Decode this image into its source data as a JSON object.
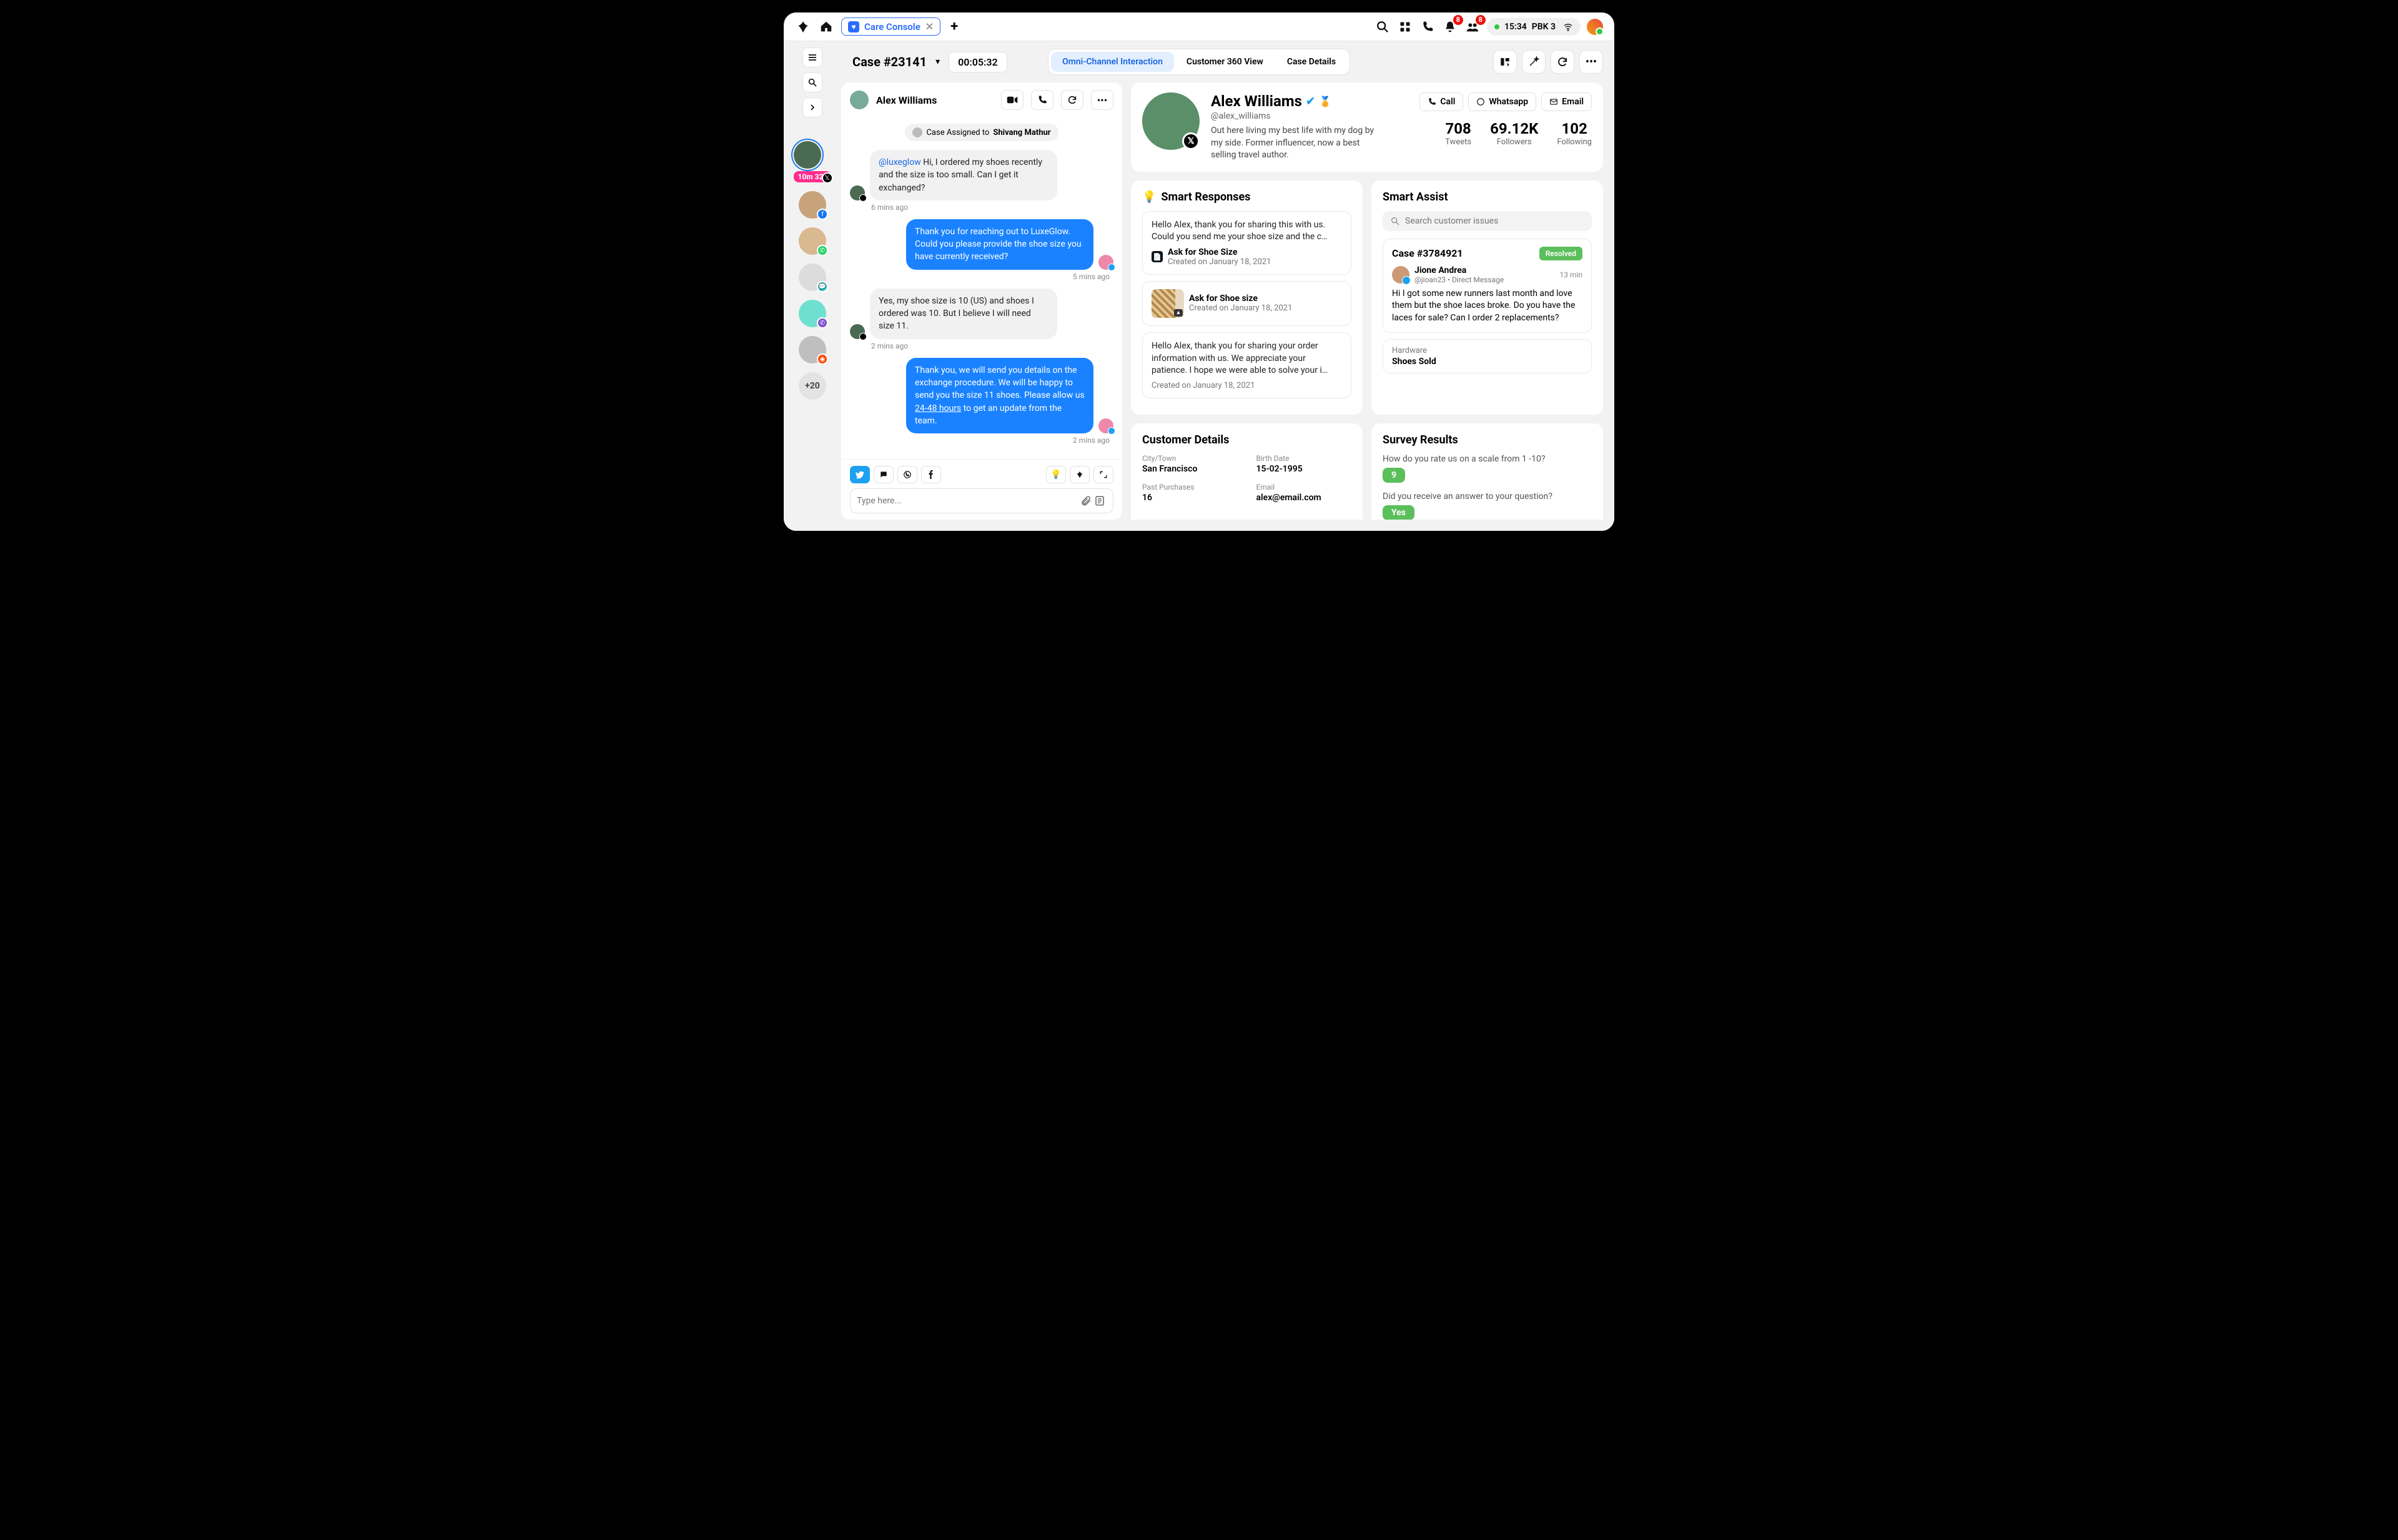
{
  "topbar": {
    "tab_label": "Care Console",
    "status_time": "15:34",
    "status_label": "PBK 3",
    "bell_badge": "8",
    "people_badge": "8"
  },
  "rail": {
    "active_timer": "10m 32s",
    "more_count": "+20"
  },
  "subheader": {
    "case_label": "Case #23141",
    "elapsed": "00:05:32",
    "tabs": [
      "Omni-Channel Interaction",
      "Customer 360 View",
      "Case Details"
    ]
  },
  "chat": {
    "name": "Alex Williams",
    "assigned_prefix": "Case Assigned to ",
    "assigned_to": "Shivang Mathur",
    "messages": [
      {
        "dir": "in",
        "mention": "@luxeglow",
        "text": " Hi, I ordered my shoes recently and the size is too small. Can I get it exchanged?",
        "ts": "6 mins ago"
      },
      {
        "dir": "out",
        "text": "Thank you for reaching out to LuxeGlow. Could you please provide the shoe size you have currently received?",
        "ts": "5 mins ago"
      },
      {
        "dir": "in",
        "text": "Yes, my shoe size is 10 (US) and shoes I ordered was 10. But I believe I will need size 11.",
        "ts": "2 mins ago"
      },
      {
        "dir": "out",
        "pre": "Thank you, we will send you details on the exchange procedure. We will be happy to send you the size 11 shoes. Please allow us ",
        "underline": "24-48 hours",
        "post": " to get an update from the team.",
        "ts": "2 mins ago"
      }
    ],
    "composer_placeholder": "Type here..."
  },
  "profile": {
    "name": "Alex Williams",
    "handle": "@alex_williams",
    "bio": "Out here living my best life with my dog by my side. Former influencer, now a best selling travel author.",
    "actions": {
      "call": "Call",
      "whatsapp": "Whatsapp",
      "email": "Email"
    },
    "stats": [
      {
        "num": "708",
        "lbl": "Tweets"
      },
      {
        "num": "69.12K",
        "lbl": "Followers"
      },
      {
        "num": "102",
        "lbl": "Following"
      }
    ]
  },
  "smart_responses": {
    "title": "Smart Responses",
    "items": [
      {
        "text": "Hello Alex, thank you for sharing this with us. Could you send me your shoe size and the c…",
        "title": "Ask for Shoe Size",
        "date": "Created on January 18, 2021",
        "type": "doc"
      },
      {
        "title": "Ask for Shoe size",
        "date": "Created on January 18, 2021",
        "type": "img"
      },
      {
        "text": "Hello Alex, thank you for sharing your order information with us. We appreciate your patience. I hope we were able to solve your i…",
        "date": "Created on January 18, 2021",
        "type": "plain"
      }
    ]
  },
  "smart_assist": {
    "title": "Smart Assist",
    "search_placeholder": "Search customer issues",
    "case": {
      "id": "Case #3784921",
      "status": "Resolved",
      "user": "Jione Andrea",
      "sub": "@jioan23 • Direct Message",
      "time": "13 min",
      "msg": "Hi I got some new runners last month and love them but the shoe laces broke. Do you have the laces for sale? Can I order 2 replacements?"
    },
    "kv": {
      "k": "Hardware",
      "v": "Shoes Sold"
    }
  },
  "customer_details": {
    "title": "Customer Details",
    "items": [
      {
        "k": "City/Town",
        "v": "San Francisco"
      },
      {
        "k": "Birth Date",
        "v": "15-02-1995"
      },
      {
        "k": "Past Purchases",
        "v": "16"
      },
      {
        "k": "Email",
        "v": "alex@email.com"
      }
    ]
  },
  "survey": {
    "title": "Survey Results",
    "q1": "How do you rate us on a scale from 1 -10?",
    "a1": "9",
    "q2": "Did you receive an answer to your question?",
    "a2": "Yes"
  }
}
